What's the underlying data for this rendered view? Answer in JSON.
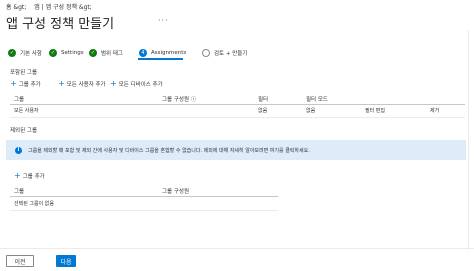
{
  "breadcrumb": {
    "home": "홈 &gt;",
    "current": "앱 | 앱 구성 정책 &gt;"
  },
  "page": {
    "title": "앱 구성 정책 만들기",
    "more": "···"
  },
  "steps": [
    {
      "label": "기본 사항",
      "state": "done"
    },
    {
      "label": "Settings",
      "state": "done"
    },
    {
      "label": "범위 태그",
      "state": "done"
    },
    {
      "label": "Assignments",
      "state": "active"
    },
    {
      "label": "검토 + 만들기",
      "state": "todo"
    }
  ],
  "included": {
    "heading": "포함된 그룹",
    "add_groups": "그룹 추가",
    "add_all_users": "모든 사용자 추가",
    "add_all_devices": "모든 디바이스 추가",
    "columns": {
      "group": "그룹",
      "members": "그룹 구성원 ⓘ",
      "filter": "필터",
      "filter_mode": "필터 모드"
    },
    "rows": [
      {
        "group": "모든 사용자",
        "members": "",
        "filter": "없음",
        "filter_mode": "없음",
        "edit": "필터 편집",
        "remove": "제거"
      }
    ]
  },
  "excluded": {
    "heading": "제외된 그룹",
    "info": "그룹을 제외할 때 포함 및 제외 간에 사용자 및 디바이스 그룹을 혼합할 수 없습니다. 제외에 대해 자세히 알아보려면 여기를 클릭하세요.",
    "learn_more": "",
    "add_groups": "그룹 추가",
    "columns": {
      "group": "그룹",
      "members": "그룹 구성원"
    },
    "empty": "선택된 그룹이 없음"
  },
  "footer": {
    "prev": "이전",
    "next": "다음"
  },
  "colors": {
    "accent": "#0078d4",
    "done": "#107c10",
    "info_bg": "#deecf9"
  }
}
